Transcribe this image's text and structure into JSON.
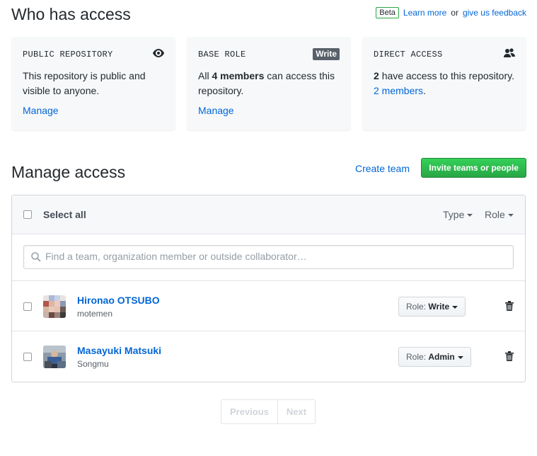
{
  "header": {
    "title": "Who has access",
    "beta": "Beta",
    "learn_more": "Learn more",
    "or": "or",
    "feedback": "give us feedback"
  },
  "cards": {
    "public": {
      "title": "PUBLIC REPOSITORY",
      "icon": "eye-icon",
      "text": "This repository is public and visible to anyone.",
      "link": "Manage"
    },
    "base_role": {
      "title": "BASE ROLE",
      "badge": "Write",
      "text_prefix": "All",
      "text_bold": "4 members",
      "text_suffix": "can access this repository.",
      "link": "Manage"
    },
    "direct": {
      "title": "DIRECT ACCESS",
      "icon": "people-icon",
      "count": "2",
      "text": "have access to this repository.",
      "link": "2 members",
      "period": "."
    }
  },
  "manage": {
    "title": "Manage access",
    "create_team": "Create team",
    "invite": "Invite teams or people"
  },
  "list": {
    "select_all": "Select all",
    "type_filter": "Type",
    "role_filter": "Role",
    "search_placeholder": "Find a team, organization member or outside collaborator…",
    "members": [
      {
        "name": "Hironao OTSUBO",
        "login": "motemen",
        "role_label": "Role:",
        "role": "Write"
      },
      {
        "name": "Masayuki Matsuki",
        "login": "Songmu",
        "role_label": "Role:",
        "role": "Admin"
      }
    ]
  },
  "pagination": {
    "previous": "Previous",
    "next": "Next"
  },
  "colors": {
    "link": "#0366d6",
    "invite_green": "#28a745",
    "card_bg": "#f6f8fa"
  }
}
